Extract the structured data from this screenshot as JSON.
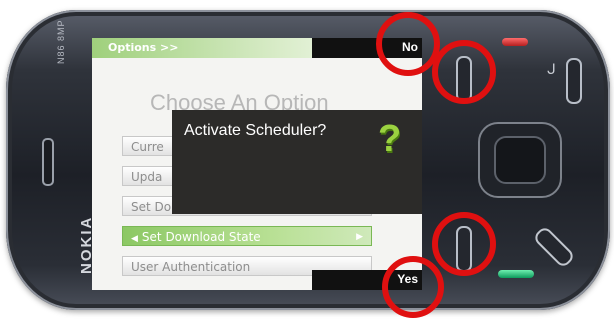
{
  "device": {
    "model": "N86 8MP",
    "brand": "NOKIA"
  },
  "screen": {
    "title": "Options >>",
    "heading": "Choose An Option",
    "softkeys": {
      "top": "No",
      "bottom": "Yes"
    },
    "menu_items": [
      {
        "label": "Curre"
      },
      {
        "label": "Upda"
      },
      {
        "label": "Set Do"
      },
      {
        "label": "Set Download State",
        "selected": true
      },
      {
        "label": "User Authentication"
      }
    ],
    "dialog": {
      "message": "Activate Scheduler?",
      "icon": "question-mark-icon"
    }
  },
  "colors": {
    "highlight": "#e01010",
    "selection": "#8cc864",
    "dialog_background": "#2c2b29"
  }
}
